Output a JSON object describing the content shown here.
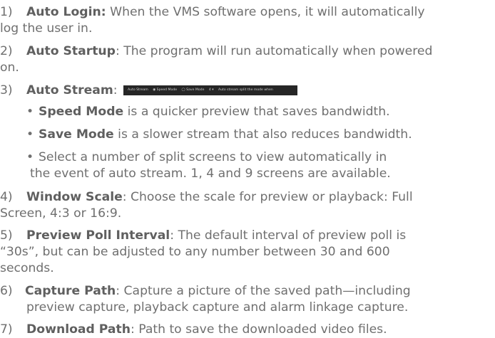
{
  "items": [
    {
      "num": "1)",
      "title": "Auto Login:",
      "text": " When the VMS software opens, it will automatically",
      "cont": "log the user in."
    },
    {
      "num": "2)",
      "title": "Auto Startup",
      "text": ": The program will run automatically when powered",
      "cont": "on."
    },
    {
      "num": "3)",
      "title": "Auto Stream",
      "text": ":"
    },
    {
      "num": "4)",
      "title": "Window Scale",
      "text": ": Choose the scale for preview or playback: Full",
      "cont": "Screen, 4:3 or 16:9."
    },
    {
      "num": "5)",
      "title": "Preview Poll Interval",
      "text": ": The default interval of preview poll is",
      "cont1": "“30s”, but can be adjusted to any number between 30 and 600",
      "cont2": "seconds."
    },
    {
      "num": "6)",
      "title": "Capture Path",
      "text": ": Capture a picture of the saved path—including",
      "cont": "preview capture, playback capture and alarm linkage capture."
    },
    {
      "num": "7)",
      "title": "Download Path",
      "text": ": Path to save the downloaded video files."
    }
  ],
  "bullets": [
    {
      "title": "Speed Mode",
      "text": " is a quicker preview that saves bandwidth."
    },
    {
      "title": "Save Mode",
      "text": " is a slower stream that also reduces bandwidth."
    },
    {
      "text": "Select a number of split screens to view automatically in",
      "cont": "the event of auto stream. 1, 4 and 9 screens are available."
    }
  ],
  "bullet_glyph": "•",
  "stream_bar": {
    "opt1": "Auto Stream",
    "opt2": "◉ Speed Mode",
    "opt3": "◯ Save Mode",
    "opt4": "4 ▾",
    "opt5": "Auto stream split the mode when"
  }
}
